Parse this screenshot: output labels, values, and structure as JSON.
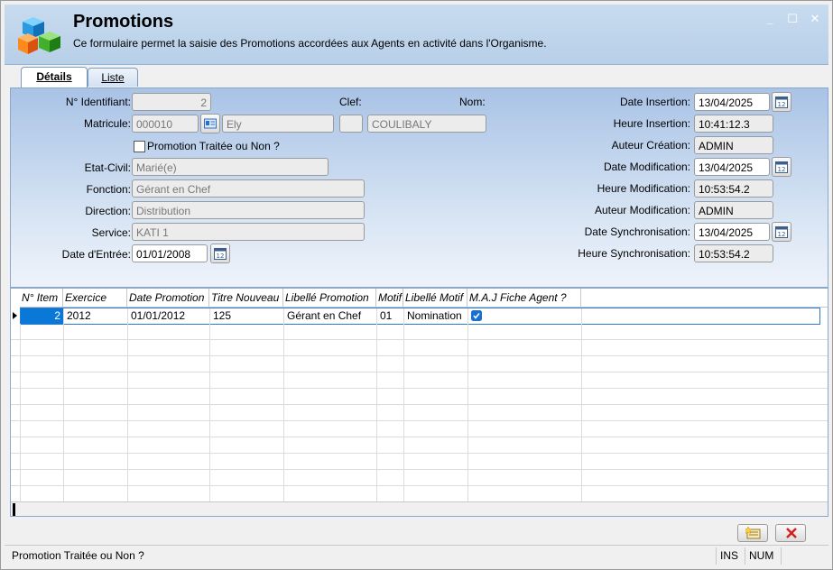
{
  "header": {
    "title": "Promotions",
    "description": "Ce formulaire permet la saisie des Promotions accordées aux Agents en activité dans l'Organisme.",
    "window_controls": [
      "_",
      "☐",
      "✕"
    ]
  },
  "tabs": [
    {
      "label": "Détails",
      "active": true
    },
    {
      "label": "Liste",
      "active": false
    }
  ],
  "form": {
    "identifiant_label": "N° Identifiant:",
    "identifiant_value": "2",
    "clef_label": "Clef:",
    "nom_label": "Nom:",
    "matricule_label": "Matricule:",
    "matricule_value": "000010",
    "prenom_value": "Ely",
    "clef_value": "",
    "nom_value": "COULIBALY",
    "promotion_traitee_label": "Promotion Traitée ou Non ?",
    "promotion_traitee_checked": false,
    "etat_civil_label": "Etat-Civil:",
    "etat_civil_value": "Marié(e)",
    "fonction_label": "Fonction:",
    "fonction_value": "Gérant en Chef",
    "direction_label": "Direction:",
    "direction_value": "Distribution",
    "service_label": "Service:",
    "service_value": "KATI 1",
    "date_entree_label": "Date d'Entrée:",
    "date_entree_value": "01/01/2008",
    "date_insertion_label": "Date Insertion:",
    "date_insertion_value": "13/04/2025",
    "heure_insertion_label": "Heure Insertion:",
    "heure_insertion_value": "10:41:12.3",
    "auteur_creation_label": "Auteur Création:",
    "auteur_creation_value": "ADMIN",
    "date_modification_label": "Date Modification:",
    "date_modification_value": "13/04/2025",
    "heure_modification_label": "Heure Modification:",
    "heure_modification_value": "10:53:54.2",
    "auteur_modification_label": "Auteur Modification:",
    "auteur_modification_value": "ADMIN",
    "date_sync_label": "Date Synchronisation:",
    "date_sync_value": "13/04/2025",
    "heure_sync_label": "Heure Synchronisation:",
    "heure_sync_value": "10:53:54.2"
  },
  "grid": {
    "columns": [
      "N° Item",
      "Exercice",
      "Date Promotion",
      "Titre Nouveau",
      "Libellé Promotion",
      "Motif",
      "Libellé Motif",
      "M.A.J Fiche Agent ?"
    ],
    "rows": [
      {
        "item": "2",
        "exercice": "2012",
        "date_promotion": "01/01/2012",
        "titre_nouveau": "125",
        "libelle_promotion": "Gérant en Chef",
        "motif": "01",
        "libelle_motif": "Nomination",
        "maj_fiche": true
      }
    ]
  },
  "statusbar": {
    "message": "Promotion Traitée ou Non ?",
    "ins": "INS",
    "num": "NUM"
  },
  "colors": {
    "header_bg": "#b7cfe8",
    "selection": "#0a78d7"
  }
}
